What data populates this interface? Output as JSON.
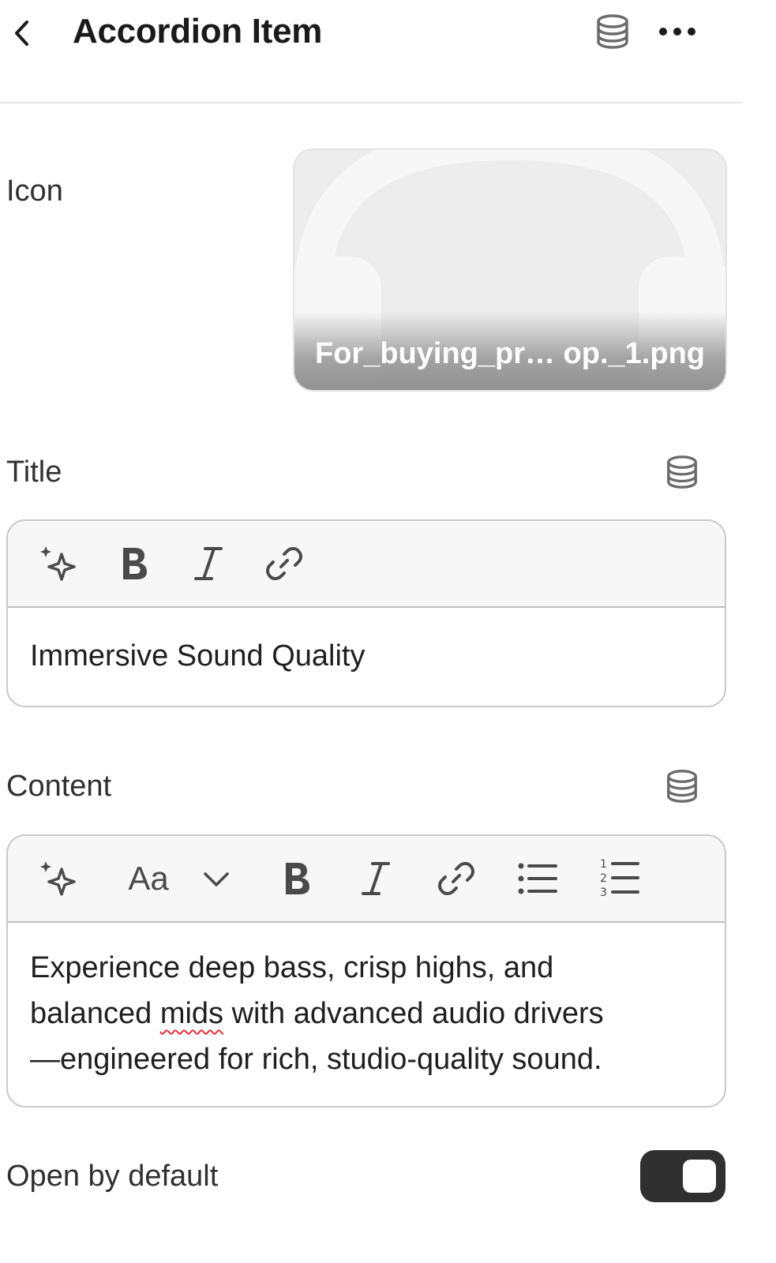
{
  "header": {
    "title": "Accordion Item",
    "back_icon": "chevron-left-icon",
    "dynamic_source_icon": "database-icon",
    "more_icon": "more-horizontal-icon"
  },
  "icon_field": {
    "label": "Icon",
    "filename": "For_buying_pr… op._1.png",
    "preview_icon": "headphones-icon"
  },
  "title_field": {
    "label": "Title",
    "value": "Immersive Sound Quality",
    "toolbar": [
      "magic-icon",
      "bold-icon",
      "italic-icon",
      "link-icon"
    ]
  },
  "content_field": {
    "label": "Content",
    "line1": "Experience deep bass, crisp highs, and",
    "line2_before": "balanced ",
    "line2_misspelled": "mids",
    "line2_after": " with advanced audio drivers",
    "line3": "—engineered for rich, studio-quality sound.",
    "toolbar": [
      "magic-icon",
      "text-style-icon",
      "chevron-down-icon",
      "bold-icon",
      "italic-icon",
      "link-icon",
      "bullet-list-icon",
      "numbered-list-icon"
    ],
    "text_style_label": "Aa"
  },
  "open_by_default": {
    "label": "Open by default",
    "checked": true
  },
  "colors": {
    "text": "#303030",
    "toggle_on": "#303030",
    "border": "#c9c9c9",
    "spellcheck": "#e0323c"
  }
}
